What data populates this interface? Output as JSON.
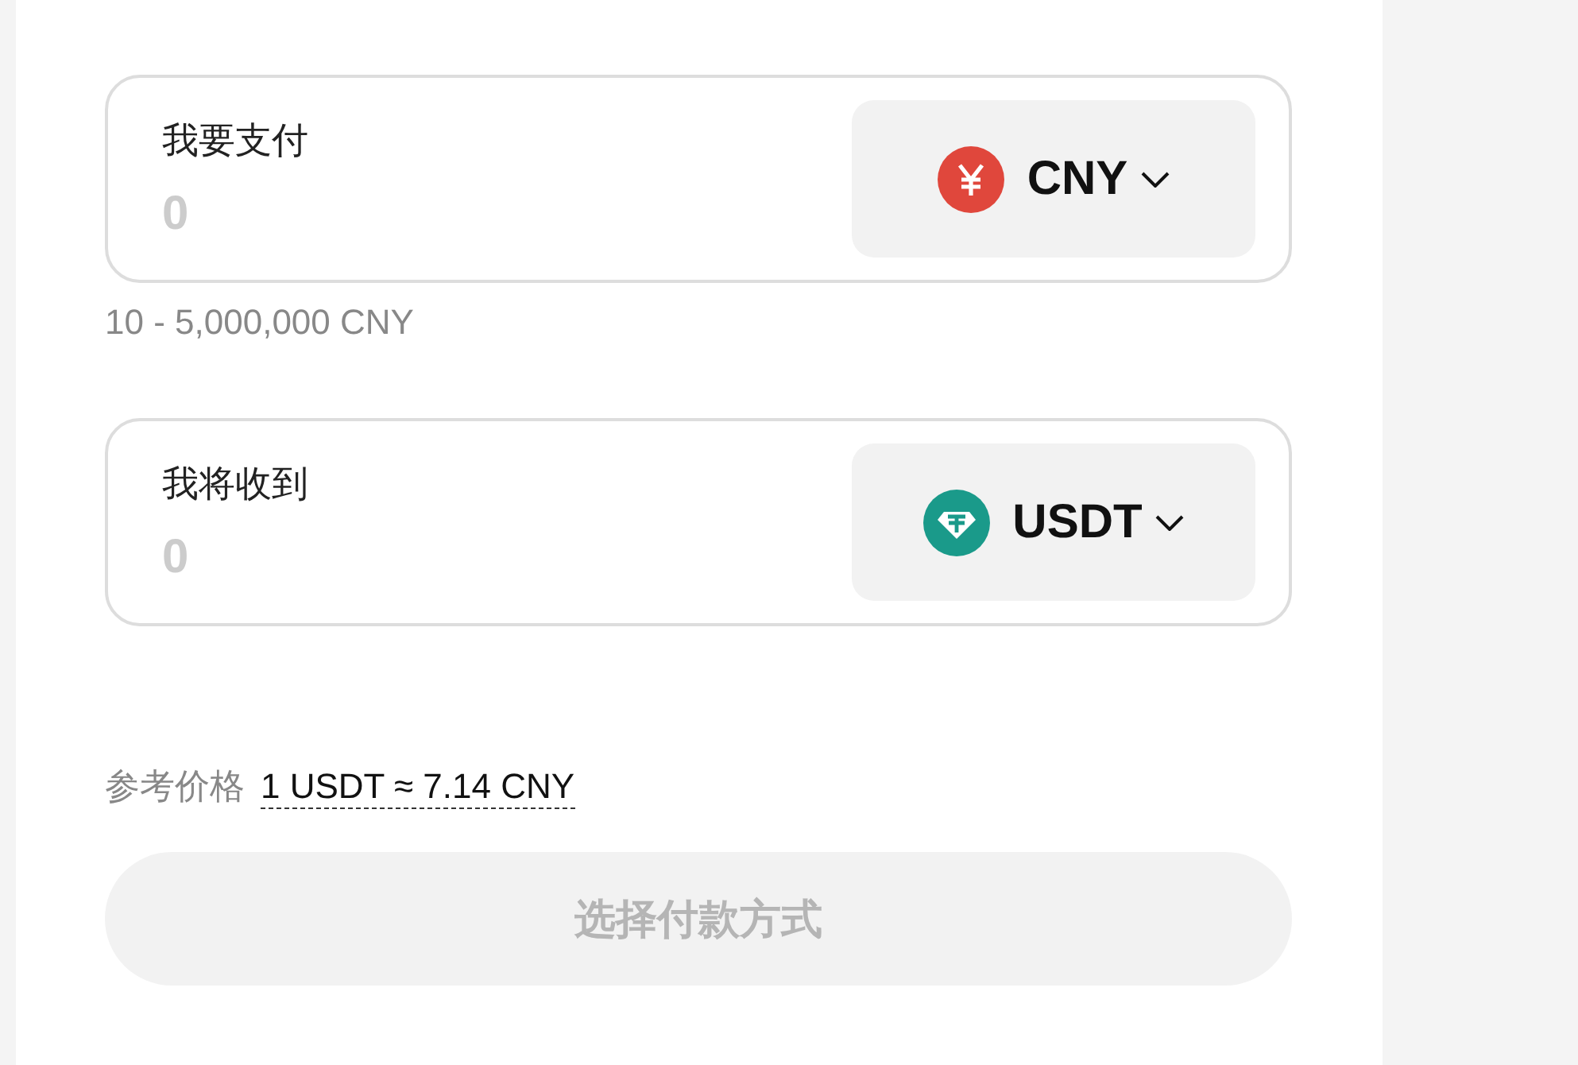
{
  "fields": [
    {
      "label": "我要支付",
      "placeholder": "0",
      "currency": {
        "code": "CNY",
        "kind": "yen"
      },
      "hint": "10 - 5,000,000 CNY"
    },
    {
      "label": "我将收到",
      "placeholder": "0",
      "currency": {
        "code": "USDT",
        "kind": "tether"
      }
    }
  ],
  "reference": {
    "label": "参考价格",
    "value": "1 USDT ≈ 7.14 CNY"
  },
  "submit": {
    "label": "选择付款方式",
    "disabled": true
  }
}
